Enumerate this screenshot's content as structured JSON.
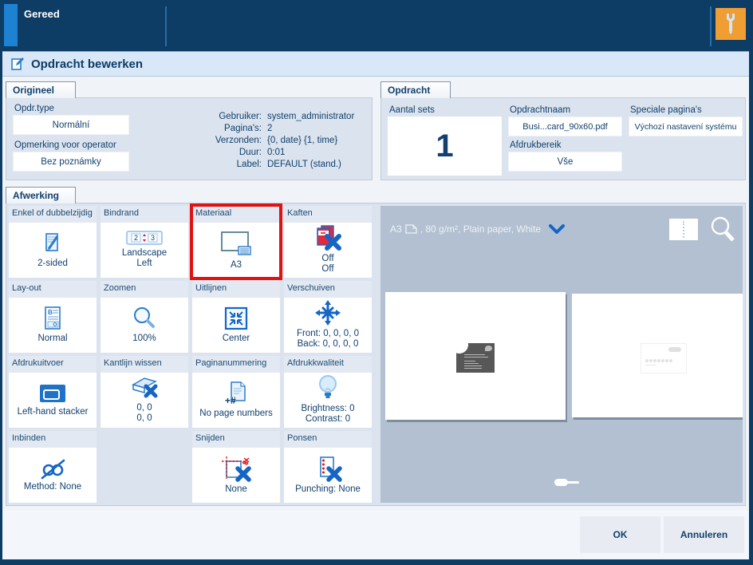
{
  "window": {
    "status": "Gereed",
    "title": "Opdracht bewerken",
    "ok_label": "OK",
    "cancel_label": "Annuleren"
  },
  "origineel": {
    "tab": "Origineel",
    "fields": [
      {
        "label": "Opdr.type",
        "value": "Normální"
      },
      {
        "label": "Opmerking voor operator",
        "value": "Bez poznámky"
      }
    ],
    "info": [
      {
        "label": "Gebruiker:",
        "value": "system_administrator"
      },
      {
        "label": "Pagina's:",
        "value": "2"
      },
      {
        "label": "Verzonden:",
        "value": "{0, date} {1, time}"
      },
      {
        "label": "Duur:",
        "value": "0:01"
      },
      {
        "label": "Label:",
        "value": "DEFAULT (stand.)"
      }
    ]
  },
  "opdracht": {
    "tab": "Opdracht",
    "sets": {
      "label": "Aantal sets",
      "value": "1"
    },
    "name": {
      "label": "Opdrachtnaam",
      "value": "Busi...card_90x60.pdf"
    },
    "range": {
      "label": "Afdrukbereik",
      "value": "Vše"
    },
    "special": {
      "label": "Speciale pagina's",
      "value": "Výchozí nastavení systému"
    }
  },
  "afwerking": {
    "tab": "Afwerking",
    "tiles": [
      {
        "label": "Enkel of dubbelzijdig",
        "value": "2-sided",
        "icon": "duplex-page-icon"
      },
      {
        "label": "Bindrand",
        "value": "Landscape\nLeft",
        "icon": "binding-edge-icon"
      },
      {
        "label": "Materiaal",
        "value": "A3",
        "icon": "media-sheet-icon",
        "highlighted": true
      },
      {
        "label": "Kaften",
        "value": "Off\nOff",
        "icon": "covers-off-icon"
      },
      {
        "label": "Lay-out",
        "value": "Normal",
        "icon": "layout-page-icon"
      },
      {
        "label": "Zoomen",
        "value": "100%",
        "icon": "magnifier-icon"
      },
      {
        "label": "Uitlijnen",
        "value": "Center",
        "icon": "align-center-icon"
      },
      {
        "label": "Verschuiven",
        "value": "Front: 0, 0, 0, 0\nBack: 0, 0, 0, 0",
        "icon": "move-arrows-icon"
      },
      {
        "label": "Afdrukuitvoer",
        "value": "Left-hand stacker",
        "icon": "stacker-tray-icon"
      },
      {
        "label": "Kantlijn wissen",
        "value": "0, 0\n0, 0",
        "icon": "eraser-cross-icon"
      },
      {
        "label": "Paginanummering",
        "value": "No page numbers",
        "icon": "page-number-icon"
      },
      {
        "label": "Afdrukkwaliteit",
        "value": "Brightness: 0\nContrast: 0",
        "icon": "bulb-icon"
      },
      {
        "label": "Inbinden",
        "value": "Method: None",
        "icon": "binding-rings-icon"
      },
      {
        "label": "Snijden",
        "value": "None",
        "icon": "trim-cross-icon"
      },
      {
        "label": "Ponsen",
        "value": "Punching: None",
        "icon": "punch-cross-icon"
      }
    ]
  },
  "preview": {
    "media_size": "A3",
    "media_rest": ", 80 g/m², Plain paper, White"
  },
  "colors": {
    "navy": "#0d3c64",
    "accent_blue": "#1e82d2",
    "icon_blue": "#2a7cc9",
    "bold_blue": "#1565c6",
    "highlight_red": "#e01212",
    "orange": "#f09d33"
  }
}
